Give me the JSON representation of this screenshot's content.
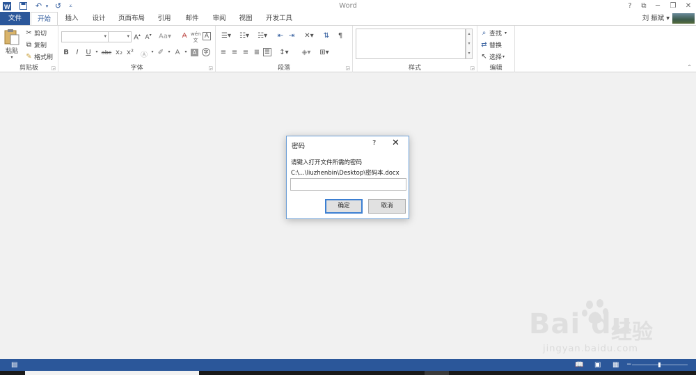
{
  "window": {
    "title": "Word",
    "controls": {
      "help": "?",
      "restore_ribbon": "⧉",
      "minimize": "─",
      "maximize": "❐",
      "close": "✕"
    }
  },
  "quick_access": {
    "icons": [
      "word-logo-icon",
      "save-icon",
      "undo-icon",
      "redo-icon",
      "customize-icon"
    ]
  },
  "tabs": [
    "文件",
    "开始",
    "插入",
    "设计",
    "页面布局",
    "引用",
    "邮件",
    "审阅",
    "视图",
    "开发工具"
  ],
  "user": {
    "name": "刘 振斌 ▾"
  },
  "ribbon": {
    "clipboard": {
      "label": "剪贴板",
      "paste": "粘贴",
      "cut": "剪切",
      "copy": "复制",
      "format_painter": "格式刷"
    },
    "font": {
      "label": "字体",
      "font_name": "",
      "font_size": "",
      "bold": "B",
      "italic": "I",
      "underline": "U",
      "strikethrough": "abc",
      "subscript": "x₂",
      "superscript": "x²"
    },
    "paragraph": {
      "label": "段落"
    },
    "styles": {
      "label": "样式"
    },
    "editing": {
      "label": "编辑",
      "find": "查找",
      "replace": "替换",
      "select": "选择"
    }
  },
  "dialog": {
    "title": "密码",
    "help": "?",
    "close": "✕",
    "prompt": "请键入打开文件所需的密码",
    "path": "C:\\...\\liuzhenbin\\Desktop\\密码本.docx",
    "password_value": "",
    "ok_label": "确定",
    "cancel_label": "取消"
  },
  "watermark": {
    "logo": "Bai du",
    "suffix": "经验",
    "url": "jingyan.baidu.com"
  },
  "colors": {
    "accent": "#2b579a",
    "workspace": "#f1f1f1",
    "dialog_border": "#6b9ed6"
  }
}
